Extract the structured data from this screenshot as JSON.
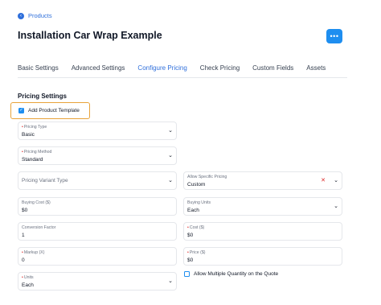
{
  "header": {
    "back_label": "Products",
    "title": "Installation Car Wrap Example",
    "more_label": "•••"
  },
  "tabs": [
    {
      "label": "Basic Settings"
    },
    {
      "label": "Advanced Settings"
    },
    {
      "label": "Configure Pricing",
      "active": true
    },
    {
      "label": "Check Pricing"
    },
    {
      "label": "Custom Fields"
    },
    {
      "label": "Assets"
    }
  ],
  "section": {
    "title": "Pricing Settings",
    "add_template_label": "Add Product Template"
  },
  "fields": {
    "pricing_type": {
      "label": "Pricing Type",
      "value": "Basic"
    },
    "pricing_method": {
      "label": "Pricing Method",
      "value": "Standard"
    },
    "pricing_variant_type": {
      "placeholder": "Pricing Variant Type"
    },
    "allow_specific_pricing": {
      "label": "Allow Specific Pricing",
      "value": "Custom"
    },
    "buying_cost": {
      "label": "Buying Cost ($)",
      "value": "$0"
    },
    "buying_units": {
      "label": "Buying Units",
      "value": "Each"
    },
    "conversion_factor": {
      "label": "Conversion Factor",
      "value": "1"
    },
    "cost": {
      "label": "Cost ($)",
      "value": "$0"
    },
    "markup": {
      "label": "Markup (X)",
      "value": "0"
    },
    "price": {
      "label": "Price ($)",
      "value": "$0"
    },
    "units": {
      "label": "Units",
      "value": "Each"
    }
  },
  "allow_multiple_quantity_label": "Allow Multiple Quantity on the Quote",
  "colors": {
    "accent": "#1e8ef0",
    "highlight": "#e8a33a",
    "required": "#dc2626"
  }
}
